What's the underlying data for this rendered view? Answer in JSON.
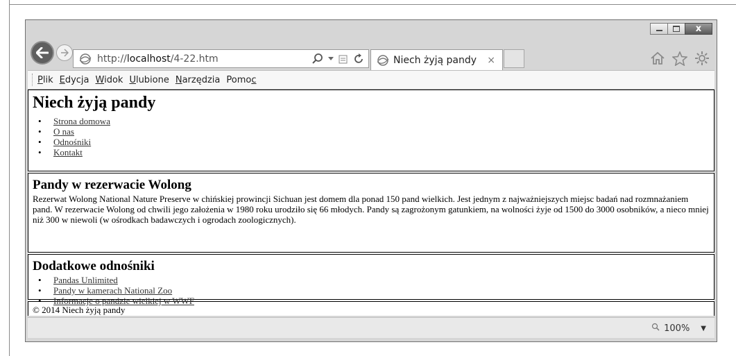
{
  "browser": {
    "url": "http://localhost/4-22.htm",
    "url_host": "localhost",
    "url_prefix": "http://",
    "url_path": "/4-22.htm",
    "tab_title": "Niech żyją pandy",
    "tab_close": "×",
    "close_glyph": "x",
    "menu": [
      {
        "label": "Plik",
        "key": "P",
        "rest": "lik"
      },
      {
        "label": "Edycja",
        "key": "E",
        "rest": "dycja"
      },
      {
        "label": "Widok",
        "key": "W",
        "rest": "idok"
      },
      {
        "label": "Ulubione",
        "key": "U",
        "rest": "lubione"
      },
      {
        "label": "Narzędzia",
        "key": "N",
        "rest": "arzędzia"
      },
      {
        "label": "Pomoc",
        "pre": "Pomo",
        "key": "c"
      }
    ],
    "zoom": "100%",
    "zoom_arrow": "▼"
  },
  "page": {
    "site_title": "Niech żyją pandy",
    "nav": [
      "Strona domowa",
      "O nas",
      "Odnośniki",
      "Kontakt"
    ],
    "main_heading": "Pandy w rezerwacie Wolong",
    "main_text": "Rezerwat Wolong National Nature Preserve w chińskiej prowincji Sichuan jest domem dla ponad 150 pand wielkich. Jest jednym z najważniejszych miejsc badań nad rozmnażaniem pand. W rezerwacie Wolong od chwili jego założenia w 1980 roku urodziło się 66 młodych. Pandy są zagrożonym gatunkiem, na wolności żyje od 1500 do 3000 osobników, a nieco mniej niż 300 w niewoli (w ośrodkach badawczych i ogrodach zoologicznych).",
    "extra_heading": "Dodatkowe odnośniki",
    "extra_links": [
      "Pandas Unlimited",
      "Pandy w kamerach National Zoo",
      "Informacje o pandzie wielkiej w WWF"
    ],
    "footer": "© 2014 Niech żyją pandy"
  },
  "colors": {
    "chrome": "#d6d6d6",
    "border": "#000000",
    "link": "#333333"
  }
}
